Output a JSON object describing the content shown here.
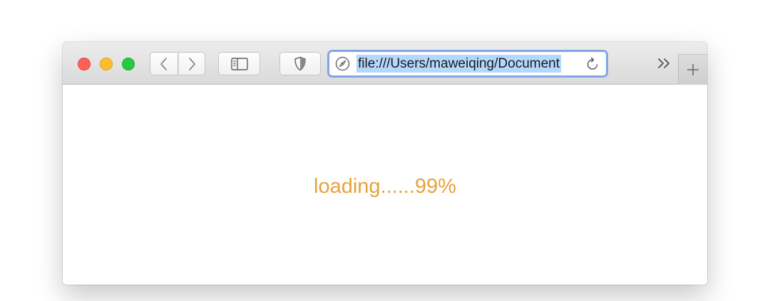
{
  "browser": {
    "address_bar": {
      "url": "file:///Users/maweiqing/Document"
    },
    "icons": {
      "close": "close-button-red",
      "minimize": "minimize-button-yellow",
      "zoom": "zoom-button-green",
      "back": "chevron-left-icon",
      "forward": "chevron-right-icon",
      "sidebar": "sidebar-icon",
      "shield": "shield-icon",
      "compass": "compass-icon",
      "reload": "reload-icon",
      "overflow": "double-chevron-right-icon",
      "new_tab": "plus-icon"
    },
    "colors": {
      "close": "#fe5f57",
      "minimize": "#febc2e",
      "zoom": "#28c840",
      "address_focus_ring": "#7ea6e6",
      "url_selection": "#b4d7fe"
    }
  },
  "page": {
    "loading_text": "loading......99%",
    "loading_color": "#e8a23a"
  }
}
